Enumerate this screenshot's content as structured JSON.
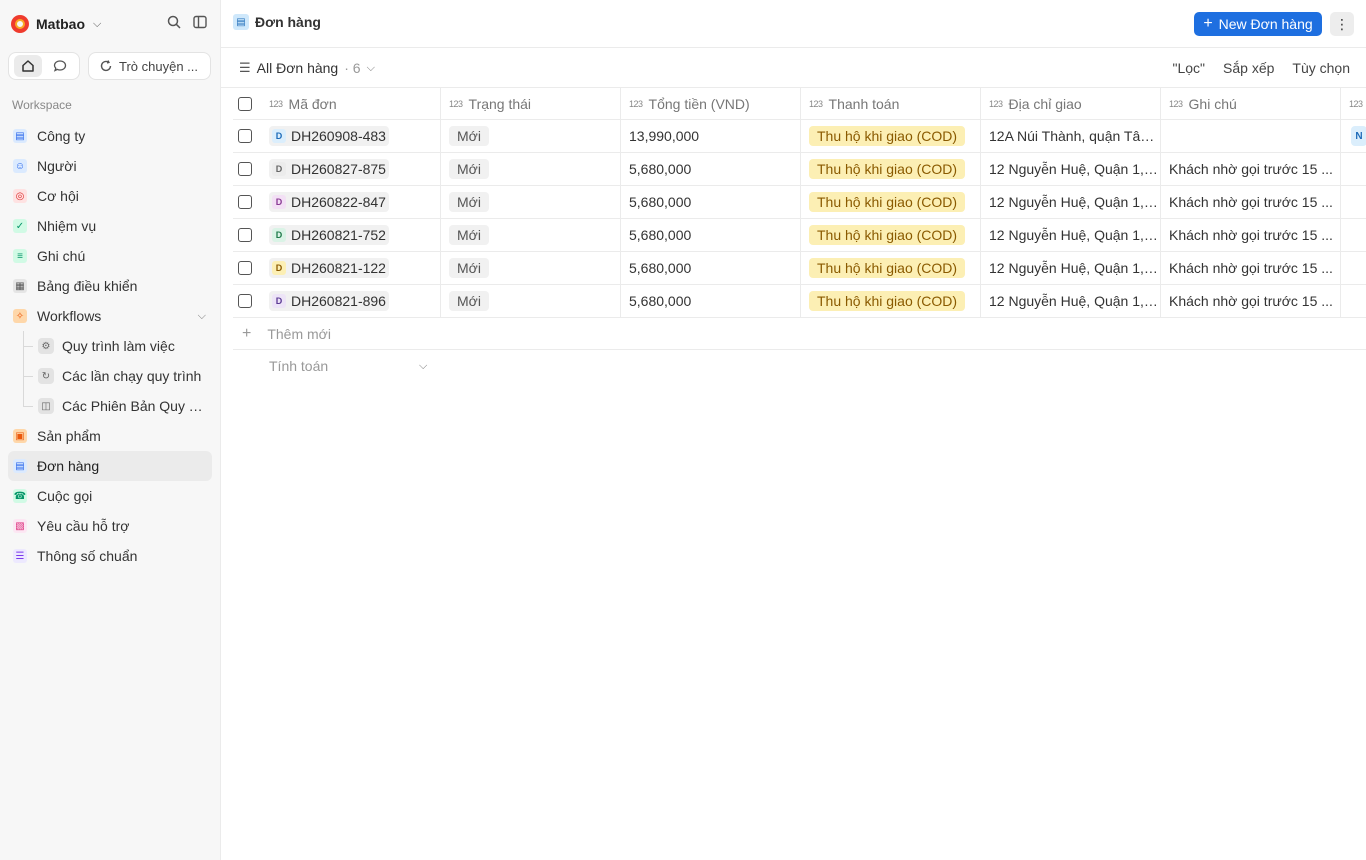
{
  "workspace": {
    "name": "Matbao"
  },
  "sidebar": {
    "chat_label": "Trò chuyện ...",
    "section_label": "Workspace",
    "items": [
      {
        "label": "Công ty",
        "icon": "building-icon",
        "color": "#dbeafe"
      },
      {
        "label": "Người",
        "icon": "user-icon",
        "color": "#dbeafe"
      },
      {
        "label": "Cơ hội",
        "icon": "target-icon",
        "color": "#fee2e2"
      },
      {
        "label": "Nhiệm vụ",
        "icon": "checkbox-icon",
        "color": "#d1fae5"
      },
      {
        "label": "Ghi chú",
        "icon": "note-icon",
        "color": "#d1fae5"
      },
      {
        "label": "Bảng điều khiển",
        "icon": "dashboard-icon",
        "color": "#e5e5e5"
      },
      {
        "label": "Workflows",
        "icon": "workflow-icon",
        "color": "#fed7aa"
      }
    ],
    "sub_items": [
      {
        "label": "Quy trình làm việc",
        "icon": "gear-icon"
      },
      {
        "label": "Các lần chạy quy trình",
        "icon": "history-icon"
      },
      {
        "label": "Các Phiên Bản Quy Trình",
        "icon": "versions-icon"
      }
    ],
    "items_after": [
      {
        "label": "Sản phẩm",
        "icon": "box-icon",
        "color": "#fed7aa"
      },
      {
        "label": "Đơn hàng",
        "icon": "cart-icon",
        "color": "#dbeafe",
        "active": true
      },
      {
        "label": "Cuộc gọi",
        "icon": "phone-icon",
        "color": "#d1fae5"
      },
      {
        "label": "Yêu cầu hỗ trợ",
        "icon": "ticket-icon",
        "color": "#fce7f3"
      },
      {
        "label": "Thông số chuẩn",
        "icon": "spec-icon",
        "color": "#ede9fe"
      }
    ]
  },
  "header": {
    "title": "Đơn hàng",
    "new_button": "New Đơn hàng"
  },
  "view": {
    "name": "All Đơn hàng",
    "count": "· 6",
    "filter": "\"Lọc\"",
    "sort": "Sắp xếp",
    "options": "Tùy chọn"
  },
  "table": {
    "columns": [
      "Mã đơn",
      "Trạng thái",
      "Tổng tiền (VND)",
      "Thanh toán",
      "Địa chỉ giao",
      "Ghi chú"
    ],
    "rows": [
      {
        "code": "DH260908-483",
        "av_color": "#dbeefc",
        "av_text_color": "#1e6bb8",
        "status": "Mới",
        "total": "13,990,000",
        "payment": "Thu hộ khi giao (COD)",
        "address": "12A Núi Thành, quận Tân ...",
        "note": "",
        "extra": "N"
      },
      {
        "code": "DH260827-875",
        "av_color": "#ececec",
        "av_text_color": "#666666",
        "status": "Mới",
        "total": "5,680,000",
        "payment": "Thu hộ khi giao (COD)",
        "address": "12 Nguyễn Huệ, Quận 1, ...",
        "note": "Khách nhờ gọi trước 15 ...",
        "extra": ""
      },
      {
        "code": "DH260822-847",
        "av_color": "#f3e0f5",
        "av_text_color": "#8a3a94",
        "status": "Mới",
        "total": "5,680,000",
        "payment": "Thu hộ khi giao (COD)",
        "address": "12 Nguyễn Huệ, Quận 1, ...",
        "note": "Khách nhờ gọi trước 15 ...",
        "extra": ""
      },
      {
        "code": "DH260821-752",
        "av_color": "#daf3e6",
        "av_text_color": "#1f7a4a",
        "status": "Mới",
        "total": "5,680,000",
        "payment": "Thu hộ khi giao (COD)",
        "address": "12 Nguyễn Huệ, Quận 1, ...",
        "note": "Khách nhờ gọi trước 15 ...",
        "extra": ""
      },
      {
        "code": "DH260821-122",
        "av_color": "#fcefb4",
        "av_text_color": "#8a5a00",
        "status": "Mới",
        "total": "5,680,000",
        "payment": "Thu hộ khi giao (COD)",
        "address": "12 Nguyễn Huệ, Quận 1, ...",
        "note": "Khách nhờ gọi trước 15 ...",
        "extra": ""
      },
      {
        "code": "DH260821-896",
        "av_color": "#ede4f7",
        "av_text_color": "#5b3a94",
        "status": "Mới",
        "total": "5,680,000",
        "payment": "Thu hộ khi giao (COD)",
        "address": "12 Nguyễn Huệ, Quận 1, ...",
        "note": "Khách nhờ gọi trước 15 ...",
        "extra": ""
      }
    ],
    "add_label": "Thêm mới",
    "calc_label": "Tính toán"
  },
  "colors": {
    "accent": "#1e6fe0",
    "cod_bg": "#fcefb4"
  }
}
